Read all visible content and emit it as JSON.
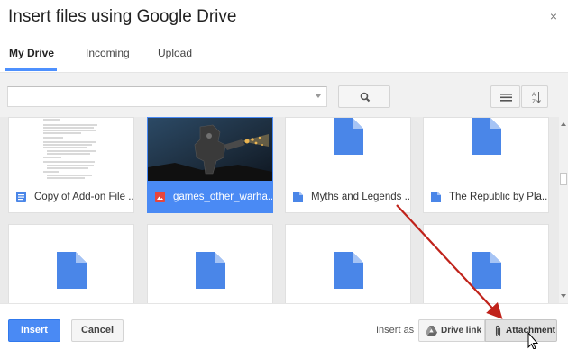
{
  "dialog": {
    "title": "Insert files using Google Drive",
    "close_glyph": "×"
  },
  "tabs": [
    {
      "label": "My Drive",
      "active": true
    },
    {
      "label": "Incoming",
      "active": false
    },
    {
      "label": "Upload",
      "active": false
    }
  ],
  "search": {
    "value": "",
    "placeholder": ""
  },
  "files": [
    {
      "name": "Copy of Add-on File ...",
      "type": "document",
      "thumb": "doc-preview",
      "selected": false
    },
    {
      "name": "games_other_warha...",
      "type": "image",
      "thumb": "photo",
      "selected": true
    },
    {
      "name": "Myths and Legends ...",
      "type": "document",
      "thumb": "doc-icon",
      "selected": false
    },
    {
      "name": "The Republic by Pla...",
      "type": "document",
      "thumb": "doc-icon",
      "selected": false
    },
    {
      "name": "",
      "type": "document",
      "thumb": "doc-icon",
      "selected": false
    },
    {
      "name": "",
      "type": "document",
      "thumb": "doc-icon",
      "selected": false
    },
    {
      "name": "",
      "type": "document",
      "thumb": "doc-icon",
      "selected": false
    },
    {
      "name": "",
      "type": "document",
      "thumb": "doc-icon",
      "selected": false
    }
  ],
  "footer": {
    "insert_label": "Insert",
    "cancel_label": "Cancel",
    "insert_as_label": "Insert as",
    "drive_link_label": "Drive link",
    "attachment_label": "Attachment"
  },
  "colors": {
    "accent": "#4a8af4",
    "doc_blue": "#4a86e8",
    "image_red": "#e8453c",
    "annotation_arrow": "#c0231b"
  },
  "icons": [
    "close-icon",
    "search-icon",
    "list-view-icon",
    "sort-az-icon",
    "document-icon",
    "image-icon",
    "drive-icon",
    "paperclip-icon",
    "mouse-cursor-icon"
  ]
}
